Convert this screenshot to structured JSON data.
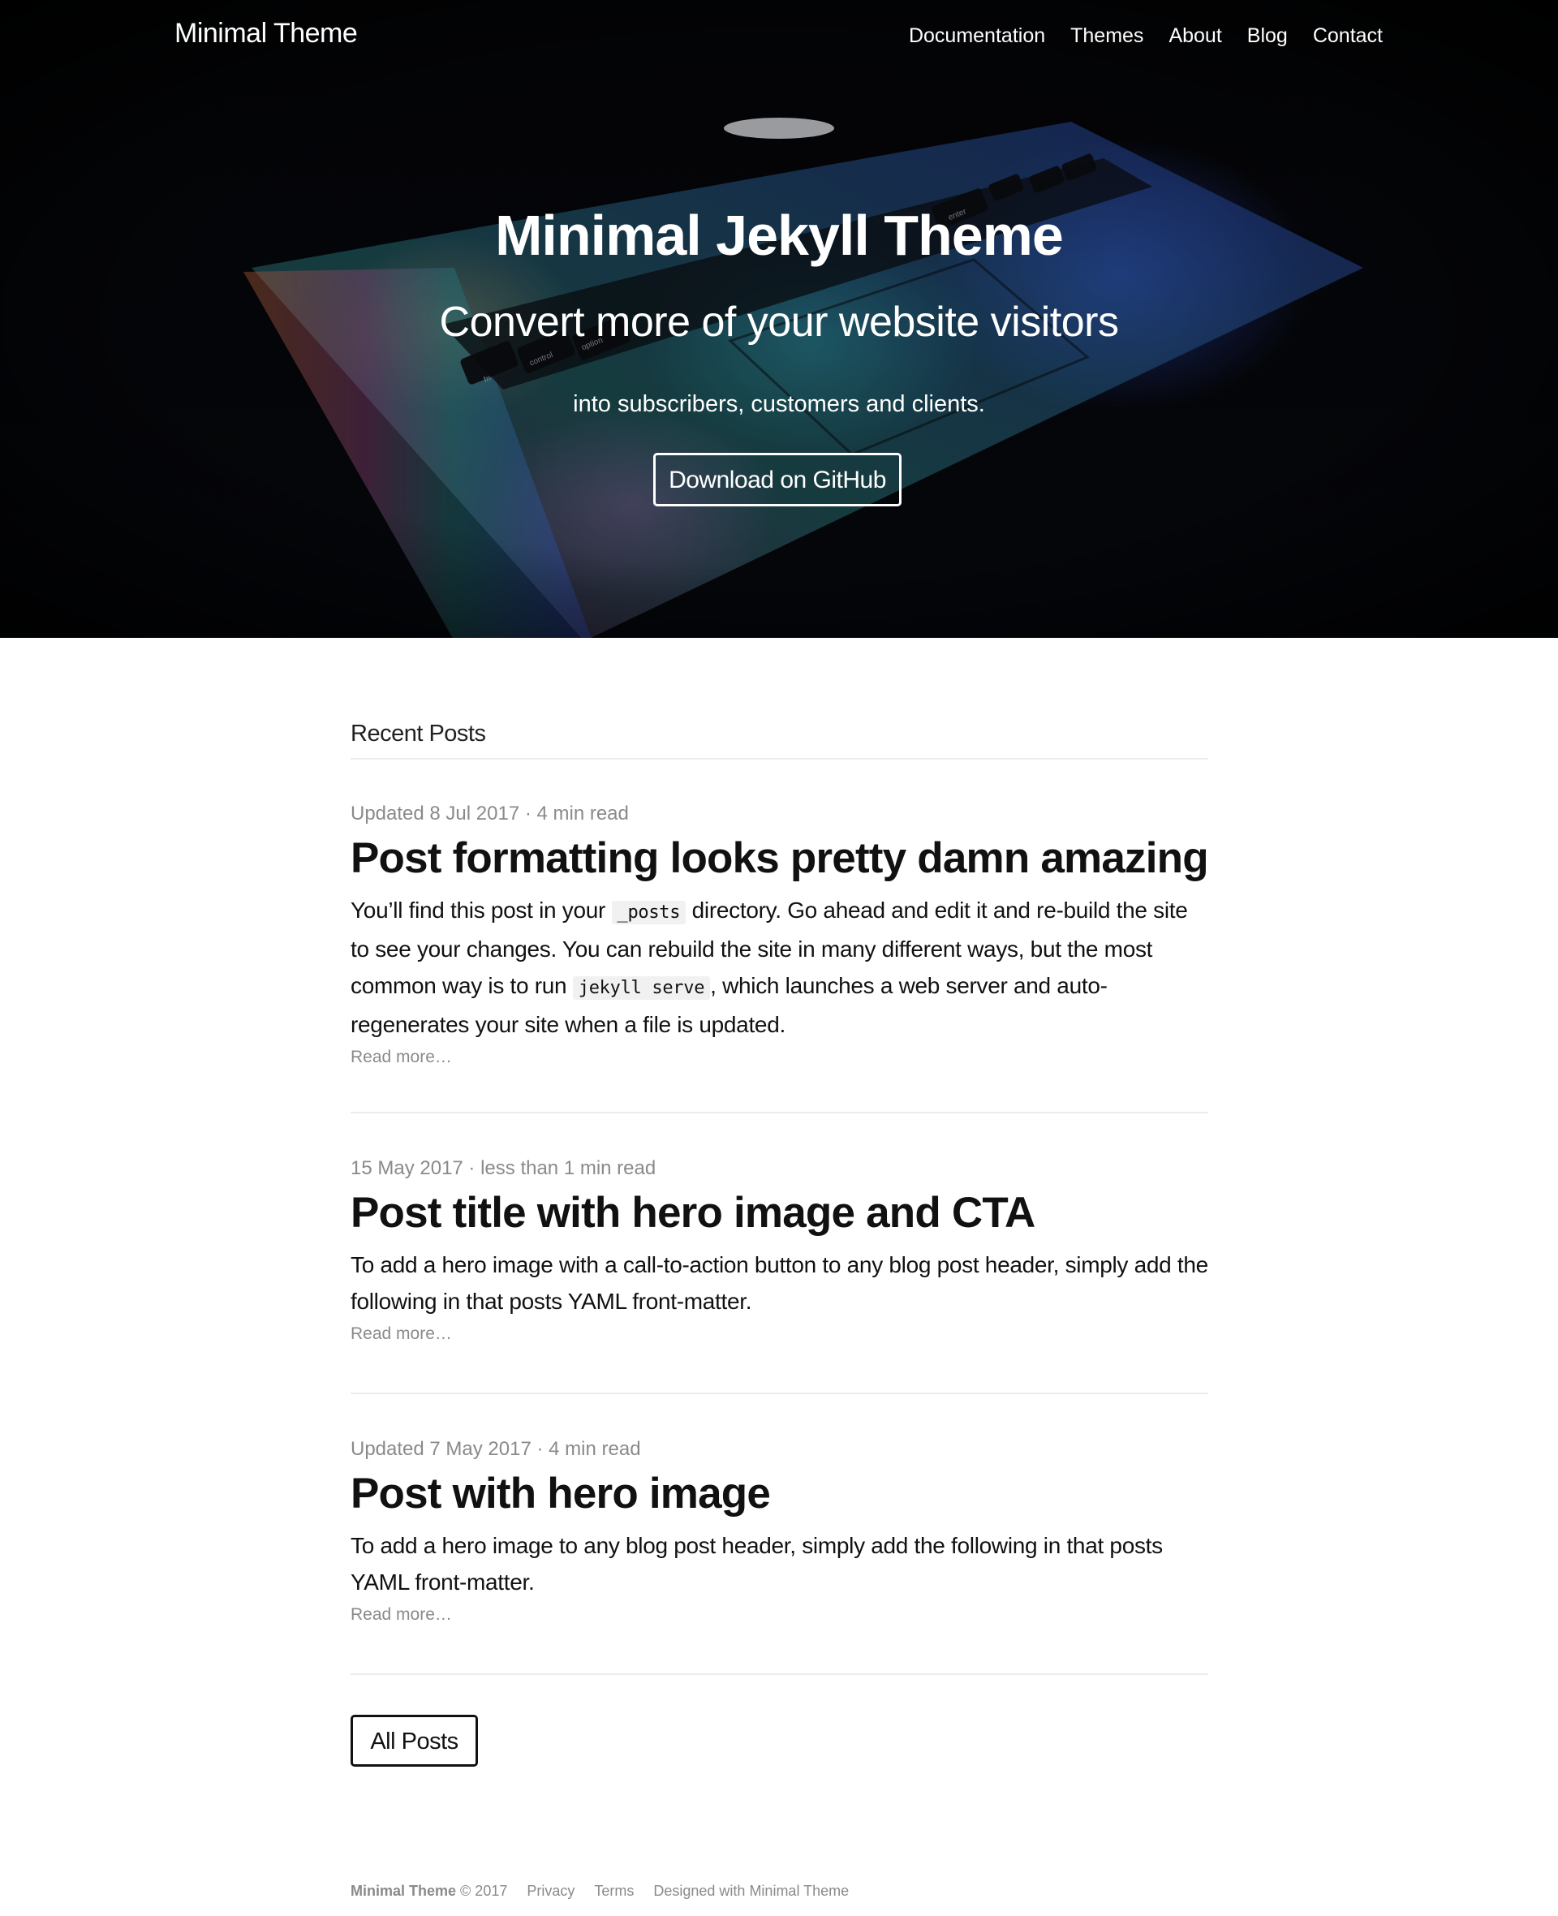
{
  "nav": {
    "brand": "Minimal Theme",
    "links": [
      "Documentation",
      "Themes",
      "About",
      "Blog",
      "Contact"
    ]
  },
  "hero": {
    "title": "Minimal Jekyll Theme",
    "subtitle": "Convert more of your website visitors",
    "tagline": "into subscribers, customers and clients.",
    "cta": "Download on GitHub",
    "keyboard_keys": [
      "fn",
      "control",
      "option",
      "enter"
    ]
  },
  "main": {
    "section_heading": "Recent Posts",
    "posts": [
      {
        "meta": "Updated 8 Jul 2017 · 4 min read",
        "title": "Post formatting looks pretty damn amazing",
        "excerpt_parts": [
          "You’ll find this post in your ",
          "_posts",
          " directory. Go ahead and edit it and re-build the site to see your changes. You can rebuild the site in many different ways, but the most common way is to run ",
          "jekyll serve",
          ", which launches a web server and auto-regenerates your site when a file is updated."
        ],
        "read_more": "Read more…"
      },
      {
        "meta": "15 May 2017 · less than 1 min read",
        "title": "Post title with hero image and CTA",
        "excerpt": "To add a hero image with a call-to-action button to any blog post header, simply add the following in that posts YAML front-matter.",
        "read_more": "Read more…"
      },
      {
        "meta": "Updated 7 May 2017 · 4 min read",
        "title": "Post with hero image",
        "excerpt": "To add a hero image to any blog post header, simply add the following in that posts YAML front-matter.",
        "read_more": "Read more…"
      }
    ],
    "all_posts_button": "All Posts"
  },
  "footer": {
    "brand": "Minimal Theme",
    "copyright": "© 2017",
    "links": [
      "Privacy",
      "Terms",
      "Designed with Minimal Theme"
    ]
  },
  "colors": {
    "hero_background": "#050608",
    "text": "#111111",
    "muted": "#8a8a8a",
    "divider": "#ececec",
    "code_background": "#f1f1f1"
  }
}
